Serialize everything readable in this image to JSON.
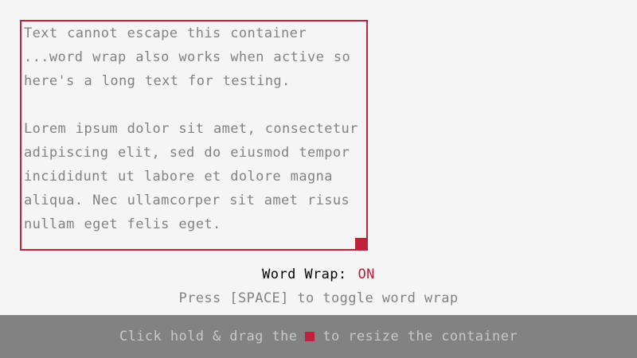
{
  "container": {
    "paragraph_1": "Text cannot escape this container ...word wrap also works when active so here's a long text for testing.",
    "paragraph_2": "Lorem ipsum dolor sit amet, consectetur adipiscing elit, sed do eiusmod tempor incididunt ut labore et dolore magna aliqua. Nec ullamcorper sit amet risus nullam eget felis eget."
  },
  "status": {
    "label": "Word Wrap:",
    "value": "ON"
  },
  "hint": "Press [SPACE] to toggle word wrap",
  "footer": {
    "before": "Click hold & drag the",
    "after": "to resize the container"
  },
  "colors": {
    "accent": "#be2139",
    "text": "#828282",
    "background": "#f5f5f5",
    "footer_bg": "#828282",
    "footer_text": "#c8c8c8"
  }
}
